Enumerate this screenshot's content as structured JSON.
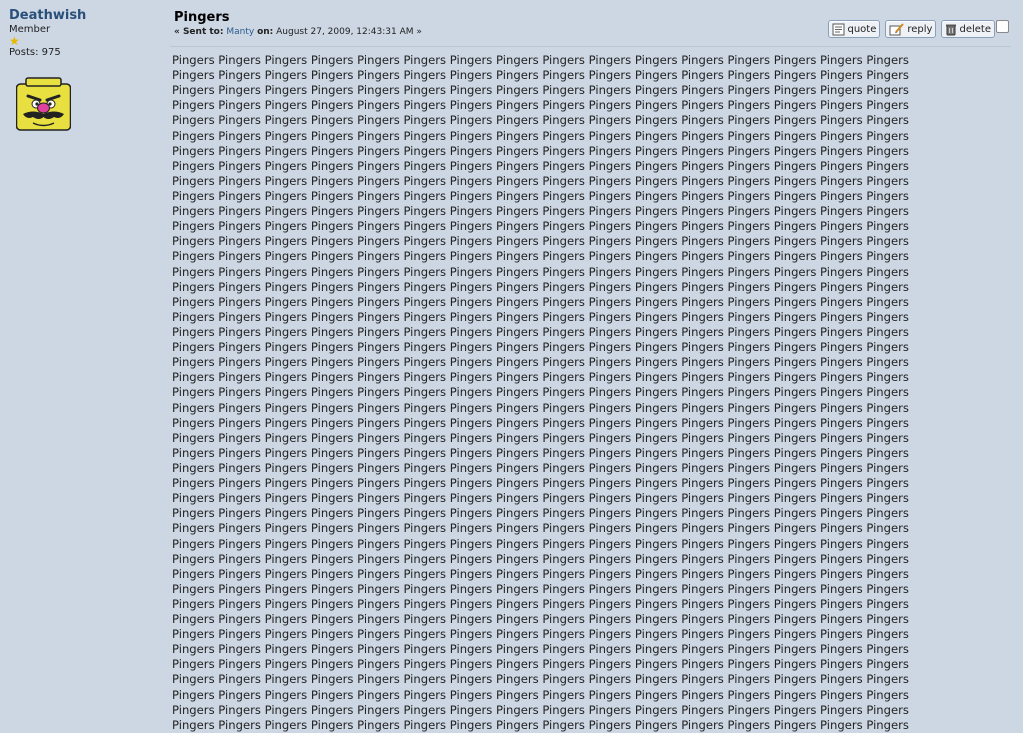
{
  "poster": {
    "name": "Deathwish",
    "group": "Member",
    "star_icon": "star-icon",
    "posts_label": "Posts: 975",
    "avatar_icon": "wario-face-avatar"
  },
  "post": {
    "title": "Pingers",
    "sent_to_prefix": "« Sent to:",
    "recipient": "Manty",
    "on_label": "on:",
    "date": "August 27, 2009, 12:43:31 AM »",
    "actions": {
      "quote": "quote",
      "reply": "reply",
      "delete": "delete"
    },
    "body_word": "Pingers",
    "body_lines": [
      16,
      16,
      16,
      16,
      16,
      16,
      16,
      16,
      16,
      16,
      16,
      16,
      16,
      16,
      16,
      16,
      16,
      16,
      16,
      16,
      16,
      16,
      16,
      16,
      16,
      16,
      16,
      16,
      16,
      16,
      16,
      16,
      16,
      16,
      16,
      16,
      16,
      16,
      16,
      16,
      16,
      16,
      16,
      16,
      16
    ]
  },
  "colors": {
    "background": "#ccd7e3",
    "name": "#2a4f7a",
    "link": "#2a5b8f"
  }
}
